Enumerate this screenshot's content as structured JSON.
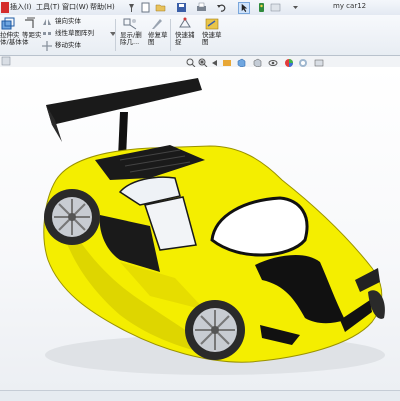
{
  "menu": {
    "items": [
      {
        "label": "插入(I)"
      },
      {
        "label": "工具(T)"
      },
      {
        "label": "窗口(W)"
      },
      {
        "label": "帮助(H)"
      }
    ]
  },
  "window_title": "my car12",
  "ribbon": {
    "left_button": "拉伸实\n体/基体",
    "equal_solid": "等距实\n体",
    "mirror_solid": "镜向实体",
    "linear_pattern": "线性草图阵列",
    "move_solid": "移动实体",
    "show_hide_relations": "显示/删\n除几...",
    "modify_sketch": "修复草\n图",
    "quick_snap": "快速捕\n捉",
    "quick_view": "快速草\n图"
  },
  "colors": {
    "car_body": "#f4ee00",
    "car_shadow": "#cfc600",
    "stripe": "#111111",
    "wing": "#1a1a1a",
    "glass": "#ffffff",
    "tire": "#2a2a2a",
    "rim": "#c8ccd2"
  },
  "icons": [
    "sketch-extrude-icon",
    "offset-icon",
    "mirror-icon",
    "linear-pattern-icon",
    "move-icon",
    "relations-icon",
    "repair-sketch-icon",
    "quick-snap-icon",
    "quick-sketch-icon",
    "zoom-fit-icon",
    "zoom-area-icon",
    "previous-view-icon",
    "section-view-icon",
    "view-orientation-icon",
    "display-style-icon",
    "hide-show-icon",
    "appearance-icon",
    "scene-icon",
    "display-settings-icon"
  ]
}
